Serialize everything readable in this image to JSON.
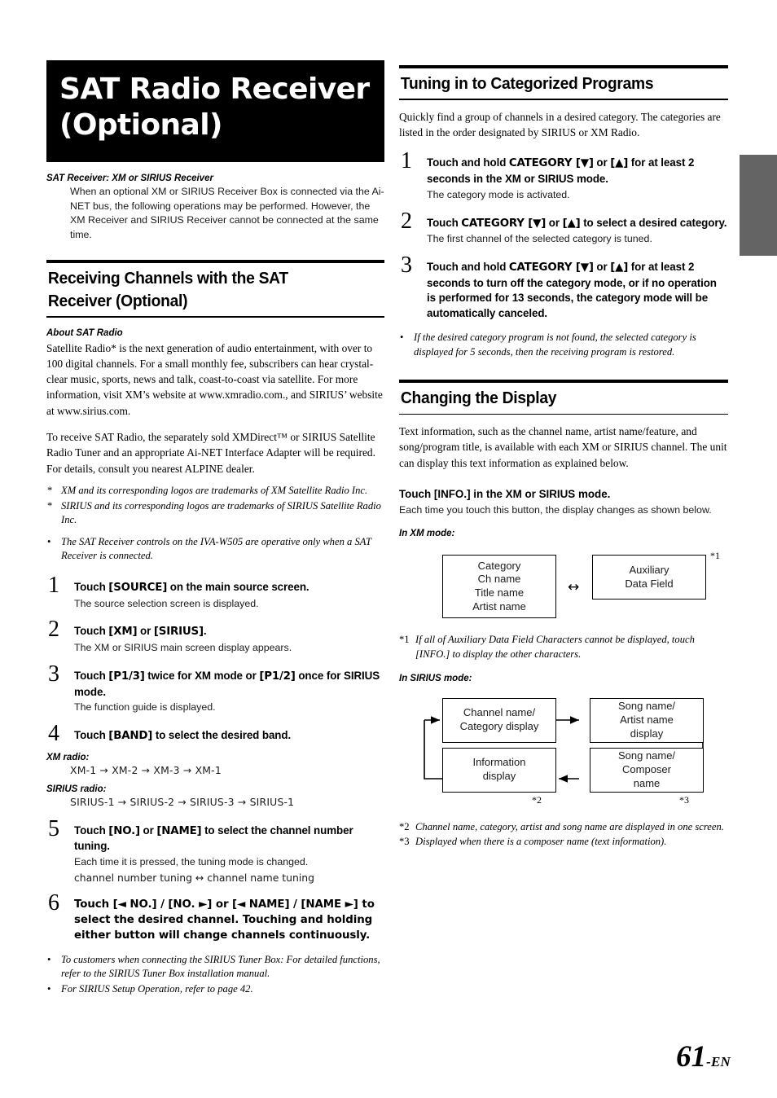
{
  "page": {
    "number": "61",
    "number_suffix": "-EN",
    "chapter_title_line1": "SAT Radio Receiver",
    "chapter_title_line2": "(Optional)"
  },
  "left": {
    "intro": {
      "heading": "SAT Receiver: XM or SIRIUS Receiver",
      "body": "When an optional XM or SIRIUS Receiver Box is connected via the Ai-NET bus, the following operations may be performed. However, the XM Receiver and SIRIUS Receiver cannot be connected at the same time."
    },
    "section_heading_line1": "Receiving Channels with the SAT",
    "section_heading_line2": "Receiver (Optional)",
    "about": {
      "heading": "About SAT Radio",
      "para1": "Satellite Radio* is the next generation of audio entertainment, with over to 100 digital channels. For a small monthly fee, subscribers can hear crystal-clear music, sports, news and talk, coast-to-coast via satellite. For more information, visit XM’s website at www.xmradio.com., and SIRIUS’ website at www.sirius.com.",
      "para2": "To receive SAT Radio, the separately sold XMDirect™ or SIRIUS Satellite Radio Tuner and an appropriate Ai-NET Interface Adapter will be required. For details, consult you nearest ALPINE dealer."
    },
    "trademark_notes": [
      {
        "marker": "*",
        "text": "XM and its corresponding logos are trademarks of XM Satellite Radio Inc."
      },
      {
        "marker": "*",
        "text": "SIRIUS and its corresponding logos are trademarks of SIRIUS Satellite Radio Inc."
      }
    ],
    "receiver_note": {
      "marker": "•",
      "text": "The SAT Receiver controls on the IVA-W505 are operative only when a SAT Receiver is connected."
    },
    "steps": [
      {
        "num": "1",
        "title_pre": "Touch ",
        "title_key": "[SOURCE]",
        "title_post": " on the main source screen.",
        "body": "The source selection screen is displayed."
      },
      {
        "num": "2",
        "title_pre": "Touch ",
        "title_key": "[XM]",
        "title_mid": " or ",
        "title_key2": "[SIRIUS]",
        "title_post": ".",
        "body": "The XM or SIRIUS main screen display appears."
      },
      {
        "num": "3",
        "title_pre": "Touch ",
        "title_key": "[P1/3]",
        "title_mid": " twice for XM mode or ",
        "title_key2": "[P1/2]",
        "title_post": " once for SIRIUS mode.",
        "body": "The function guide is displayed."
      },
      {
        "num": "4",
        "title_pre": "Touch ",
        "title_key": "[BAND]",
        "title_post": " to select the desired band.",
        "body": ""
      },
      {
        "num": "5",
        "title_pre": "Touch ",
        "title_key": "[NO.]",
        "title_mid": " or ",
        "title_key2": "[NAME]",
        "title_post": " to select the channel number tuning.",
        "body": "Each time it is pressed, the tuning mode is changed.",
        "body2": "channel number tuning ↔ channel name tuning"
      },
      {
        "num": "6",
        "title_full": "Touch [◄ NO.] / [NO. ►] or [◄ NAME] / [NAME ►] to select the desired channel. Touching and holding either button will change channels continuously.",
        "body": ""
      }
    ],
    "bands": {
      "xm_label": "XM radio:",
      "xm_sequence": "XM-1 → XM-2 → XM-3 → XM-1",
      "sirius_label": "SIRIUS radio:",
      "sirius_sequence": "SIRIUS-1 → SIRIUS-2 → SIRIUS-3 → SIRIUS-1"
    },
    "end_notes": [
      {
        "marker": "•",
        "text": "To customers when connecting the SIRIUS Tuner Box: For detailed functions, refer to the SIRIUS Tuner Box installation manual."
      },
      {
        "marker": "•",
        "text": "For SIRIUS Setup Operation, refer to page 42."
      }
    ]
  },
  "right": {
    "section1_heading": "Tuning in to Categorized Programs",
    "section1_intro": "Quickly find a group of channels in a desired category. The categories are listed in the order designated by SIRIUS or XM Radio.",
    "steps": [
      {
        "num": "1",
        "title_pre": "Touch and hold ",
        "title_key": "CATEGORY [▼]",
        "title_mid": " or ",
        "title_key2": "[▲]",
        "title_post": " for at least 2 seconds in the XM or SIRIUS mode.",
        "body": "The category mode is activated."
      },
      {
        "num": "2",
        "title_pre": "Touch ",
        "title_key": "CATEGORY [▼]",
        "title_mid": " or ",
        "title_key2": "[▲]",
        "title_post": " to select a desired category.",
        "body": "The first channel of the selected category is tuned."
      },
      {
        "num": "3",
        "title_pre": "Touch and hold ",
        "title_key": "CATEGORY [▼]",
        "title_mid": " or ",
        "title_key2": "[▲]",
        "title_post": " for at least 2 seconds to turn off the category mode, or if no operation is performed for 13 seconds, the category mode will be automatically canceled.",
        "body": ""
      }
    ],
    "section1_note": {
      "marker": "•",
      "text": "If the desired category program is not found, the selected category is displayed for 5 seconds, then the receiving program is restored."
    },
    "section2_heading": "Changing the Display",
    "section2_intro": "Text information, such as the channel name, artist name/feature, and song/program title, is available with each XM or SIRIUS channel. The unit can display this text information as explained below.",
    "touch_info_pre": "Touch ",
    "touch_info_key": "[INFO.]",
    "touch_info_post": " in the XM or SIRIUS mode.",
    "touch_info_body": "Each time you touch this button, the display changes as shown below.",
    "xm_mode_label": "In XM mode:",
    "xm_diagram": {
      "box_left_lines": [
        "Category",
        "Ch name",
        "Title name",
        "Artist name"
      ],
      "box_right_lines": [
        "Auxiliary",
        "Data Field"
      ],
      "symbol": "↔",
      "right_marker": "*1"
    },
    "footnote1": {
      "marker": "*1",
      "text": "If all of Auxiliary Data Field Characters cannot be displayed, touch [INFO.] to display the other characters."
    },
    "sirius_mode_label": "In SIRIUS mode:",
    "sirius_diagram": {
      "box_tl_lines": [
        "Channel name/",
        "Category display"
      ],
      "box_tr_lines": [
        "Song name/",
        "Artist name",
        "display"
      ],
      "box_bl_lines": [
        "Information",
        "display"
      ],
      "box_br_lines": [
        "Song name/",
        "Composer",
        "name"
      ],
      "marker_bl": "*2",
      "marker_br": "*3"
    },
    "footnote2": {
      "marker": "*2",
      "text": "Channel name, category, artist and song name are displayed in one screen."
    },
    "footnote3": {
      "marker": "*3",
      "text": "Displayed when there is a composer name (text information)."
    }
  }
}
